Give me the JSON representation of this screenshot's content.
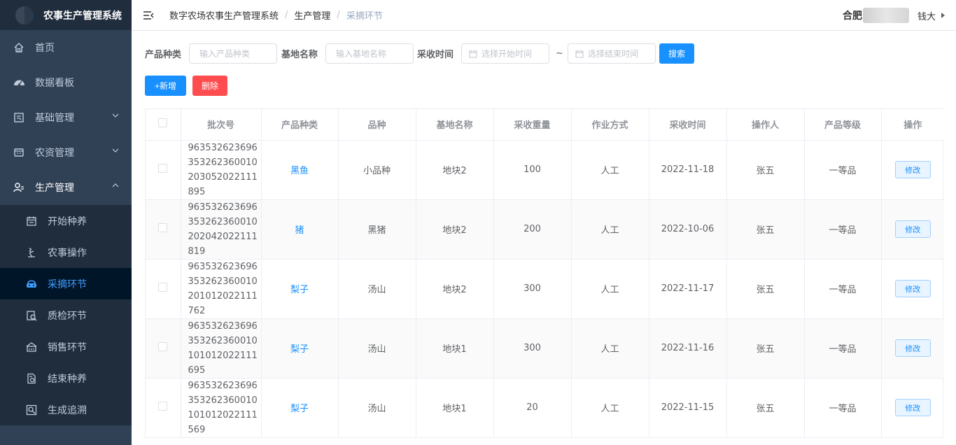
{
  "app": {
    "title": "农事生产管理系统"
  },
  "sidebar": {
    "items": [
      {
        "label": "首页",
        "icon": "home-icon"
      },
      {
        "label": "数据看板",
        "icon": "dashboard-icon"
      },
      {
        "label": "基础管理",
        "icon": "base-manage-icon"
      },
      {
        "label": "农资管理",
        "icon": "supplies-icon"
      },
      {
        "label": "生产管理",
        "icon": "production-icon"
      }
    ],
    "sub_items": [
      {
        "label": "开始种养",
        "icon": "calendar-icon"
      },
      {
        "label": "农事操作",
        "icon": "farmer-icon"
      },
      {
        "label": "采摘环节",
        "icon": "basket-icon"
      },
      {
        "label": "质检环节",
        "icon": "inspect-icon"
      },
      {
        "label": "销售环节",
        "icon": "store-icon"
      },
      {
        "label": "结束种养",
        "icon": "finish-icon"
      },
      {
        "label": "生成追溯",
        "icon": "trace-icon"
      }
    ],
    "active": "采摘环节"
  },
  "header": {
    "breadcrumb": [
      "数字农场农事生产管理系统",
      "生产管理",
      "采摘环节"
    ],
    "city": "合肥",
    "user": "钱大"
  },
  "search": {
    "product_label": "产品种类",
    "product_placeholder": "输入产品种类",
    "base_label": "基地名称",
    "base_placeholder": "输入基地名称",
    "time_label": "采收时间",
    "start_placeholder": "选择开始时间",
    "tilde": "~",
    "end_placeholder": "选择结束时间",
    "search_label": "搜索"
  },
  "toolbar": {
    "add_label": "+新增",
    "delete_label": "删除"
  },
  "table": {
    "columns": [
      "批次号",
      "产品种类",
      "品种",
      "基地名称",
      "采收重量",
      "作业方式",
      "采收时间",
      "操作人",
      "产品等级",
      "操作"
    ],
    "edit_label": "修改",
    "rows": [
      {
        "batch": "963532623696353262360010203052022111895",
        "product": "黑鱼",
        "variety": "小品种",
        "base": "地块2",
        "weight": "100",
        "method": "人工",
        "time": "2022-11-18",
        "operator": "张五",
        "grade": "一等品"
      },
      {
        "batch": "963532623696353262360010202042022111819",
        "product": "猪",
        "variety": "黑猪",
        "base": "地块2",
        "weight": "200",
        "method": "人工",
        "time": "2022-10-06",
        "operator": "张五",
        "grade": "一等品"
      },
      {
        "batch": "963532623696353262360010201012022111762",
        "product": "梨子",
        "variety": "汤山",
        "base": "地块2",
        "weight": "300",
        "method": "人工",
        "time": "2022-11-17",
        "operator": "张五",
        "grade": "一等品"
      },
      {
        "batch": "963532623696353262360010101012022111695",
        "product": "梨子",
        "variety": "汤山",
        "base": "地块1",
        "weight": "300",
        "method": "人工",
        "time": "2022-11-16",
        "operator": "张五",
        "grade": "一等品"
      },
      {
        "batch": "963532623696353262360010101012022111569",
        "product": "梨子",
        "variety": "汤山",
        "base": "地块1",
        "weight": "20",
        "method": "人工",
        "time": "2022-11-15",
        "operator": "张五",
        "grade": "一等品"
      }
    ]
  },
  "colors": {
    "primary": "#1890ff",
    "danger": "#ff4d4f",
    "sidebar": "#304156",
    "active_sub": "#001528"
  }
}
